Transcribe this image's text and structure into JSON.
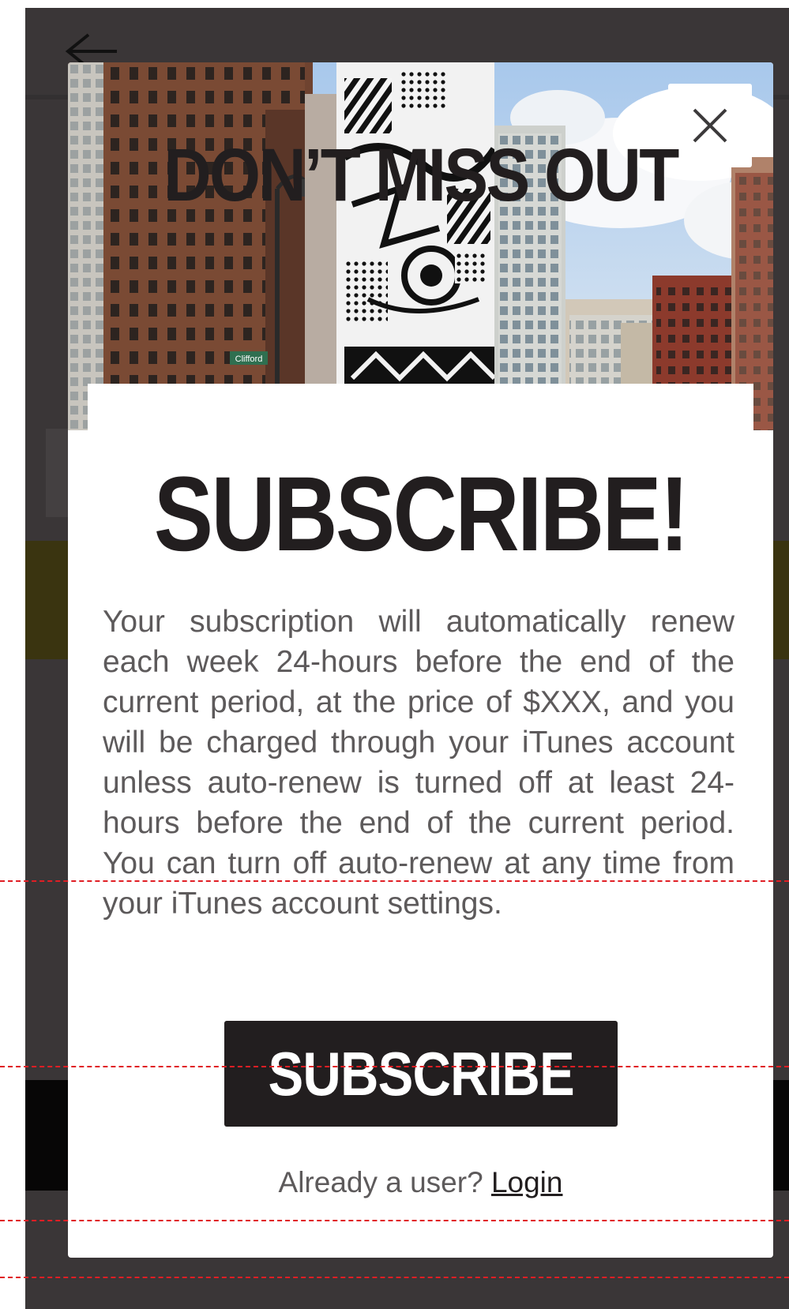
{
  "modal": {
    "headline": "DON’T MISS OUT",
    "cta_heading": "SUBSCRIBE!",
    "body": "Your subscription will automatically renew each week 24-hours before the end of the current period, at the price of $XXX, and you will be charged through your iTunes account unless auto-renew is turned off at least 24-hours before the end of the current period. You can turn off auto-renew at any time from your iTunes account settings.",
    "subscribe_label": "SUBSCRIBE",
    "login_prompt": "Already a user?",
    "login_label": "Login",
    "street_sign": "Clifford"
  },
  "icons": {
    "back": "arrow-left-icon",
    "close": "close-icon"
  },
  "colors": {
    "backdrop": "#3a3637",
    "text_dark": "#221e1f",
    "text_body": "#5d5a5b",
    "button_bg": "#221e1f",
    "guide_line": "#e01e24"
  }
}
